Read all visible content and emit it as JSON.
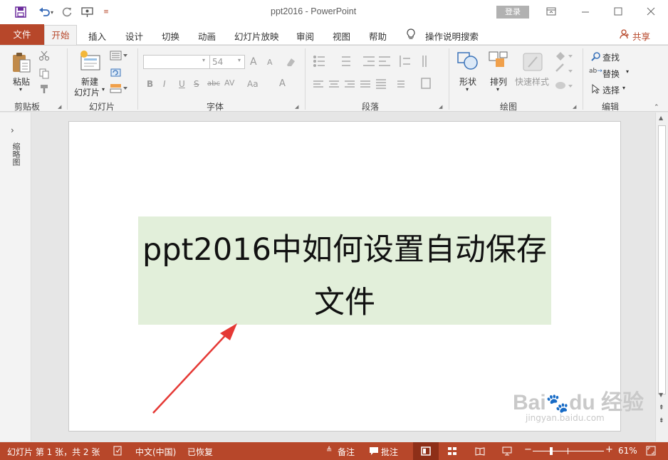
{
  "window": {
    "title": "ppt2016 - PowerPoint",
    "login_label": "登录",
    "share_label": "共享"
  },
  "tabs": {
    "file": "文件",
    "items": [
      "开始",
      "插入",
      "设计",
      "切换",
      "动画",
      "幻灯片放映",
      "审阅",
      "视图",
      "帮助"
    ],
    "search_hint": "操作说明搜索"
  },
  "ribbon": {
    "clipboard": {
      "paste": "粘贴",
      "group": "剪贴板"
    },
    "slides": {
      "new_slide_line1": "新建",
      "new_slide_line2": "幻灯片",
      "group": "幻灯片"
    },
    "font": {
      "size": "54",
      "bold": "B",
      "italic": "I",
      "underline": "U",
      "strike": "S",
      "shadow": "abc",
      "spacing": "AV",
      "case": "Aa",
      "grow": "A",
      "shrink": "A",
      "color": "A",
      "group": "字体"
    },
    "paragraph": {
      "group": "段落"
    },
    "drawing": {
      "shapes": "形状",
      "arrange": "排列",
      "quick_styles": "快速样式",
      "group": "绘图"
    },
    "editing": {
      "find": "查找",
      "replace": "替换",
      "select": "选择",
      "group": "编辑"
    }
  },
  "left_pane": {
    "label": "缩略图"
  },
  "slide": {
    "title_line1": "ppt2016中如何设置自动保存",
    "title_line2": "文件"
  },
  "status": {
    "slide_info": "幻灯片 第 1 张，共 2 张",
    "language": "中文(中国)",
    "recovered": "已恢复",
    "notes": "备注",
    "comments": "批注",
    "zoom": "61%"
  },
  "colors": {
    "accent": "#b7472a",
    "title_fill": "#e2efda",
    "arrow": "#e53935"
  }
}
